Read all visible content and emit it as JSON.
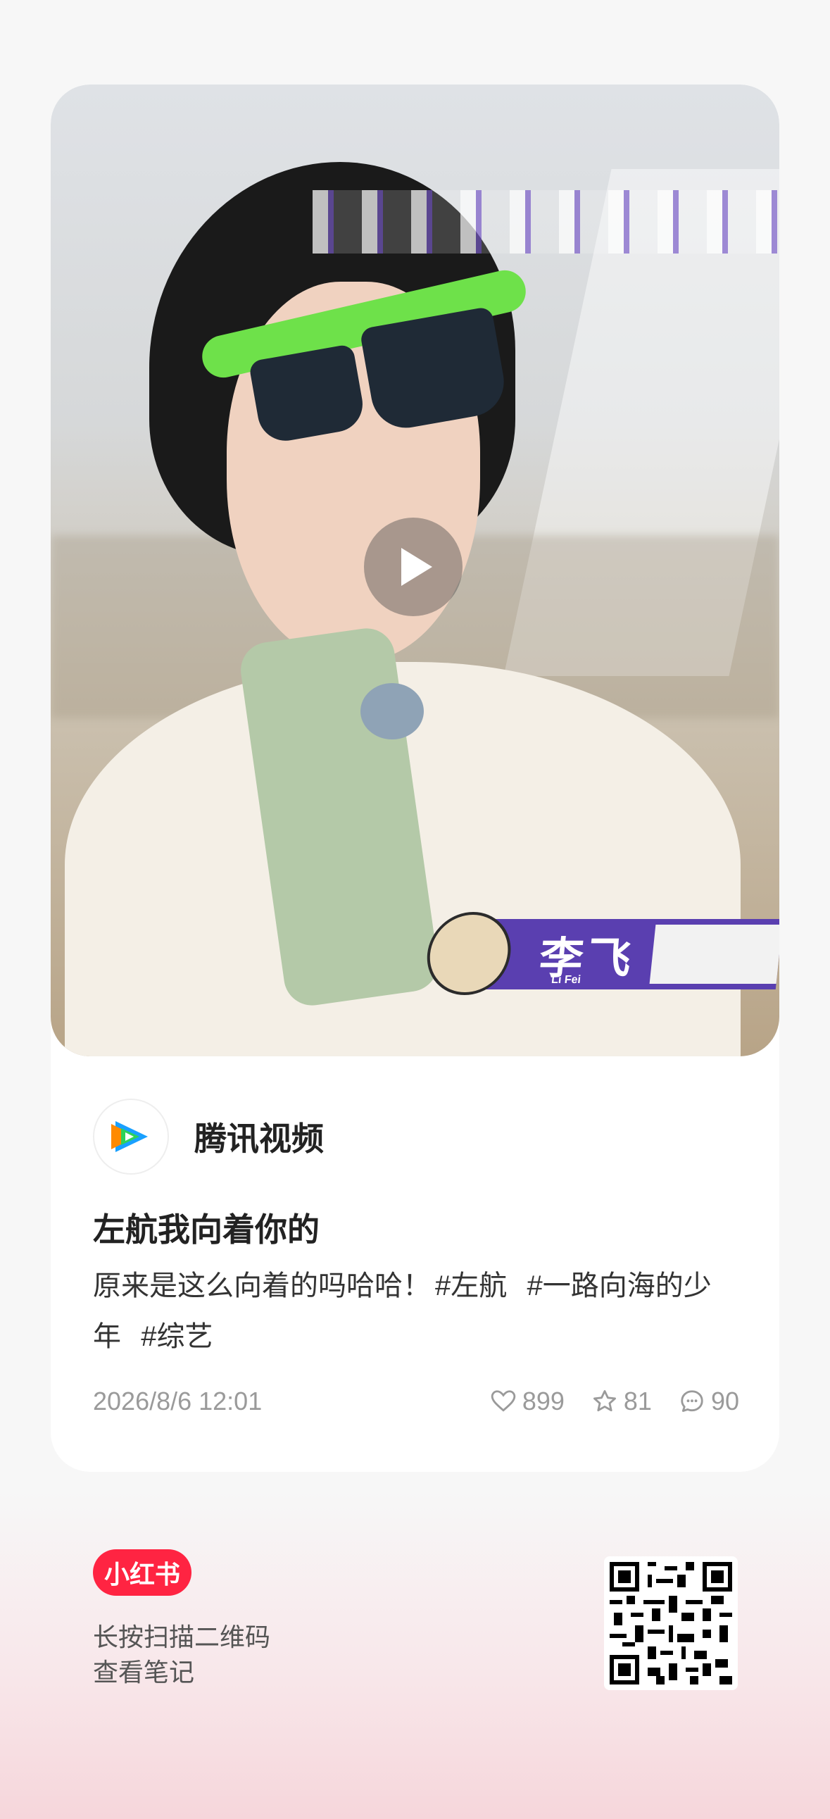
{
  "post": {
    "video": {
      "overlay_name": "李飞",
      "overlay_romanization": "Li Fei"
    },
    "author": {
      "name": "腾讯视频",
      "avatar_icon": "tencent-video-logo-icon"
    },
    "title": "左航我向着你的",
    "description": "原来是这么向着的吗哈哈！",
    "tags": [
      "#左航",
      "#一路向海的少年",
      "#综艺"
    ],
    "timestamp": "2026/8/6 12:01",
    "stats": {
      "likes": "899",
      "collects": "81",
      "comments": "90"
    }
  },
  "footer": {
    "brand": "小红书",
    "hint_line1": "长按扫描二维码",
    "hint_line2": "查看笔记"
  },
  "colors": {
    "brand_red": "#ff2442",
    "overlay_purple": "#5a3fb0",
    "meta_gray": "#9a9a9a"
  }
}
